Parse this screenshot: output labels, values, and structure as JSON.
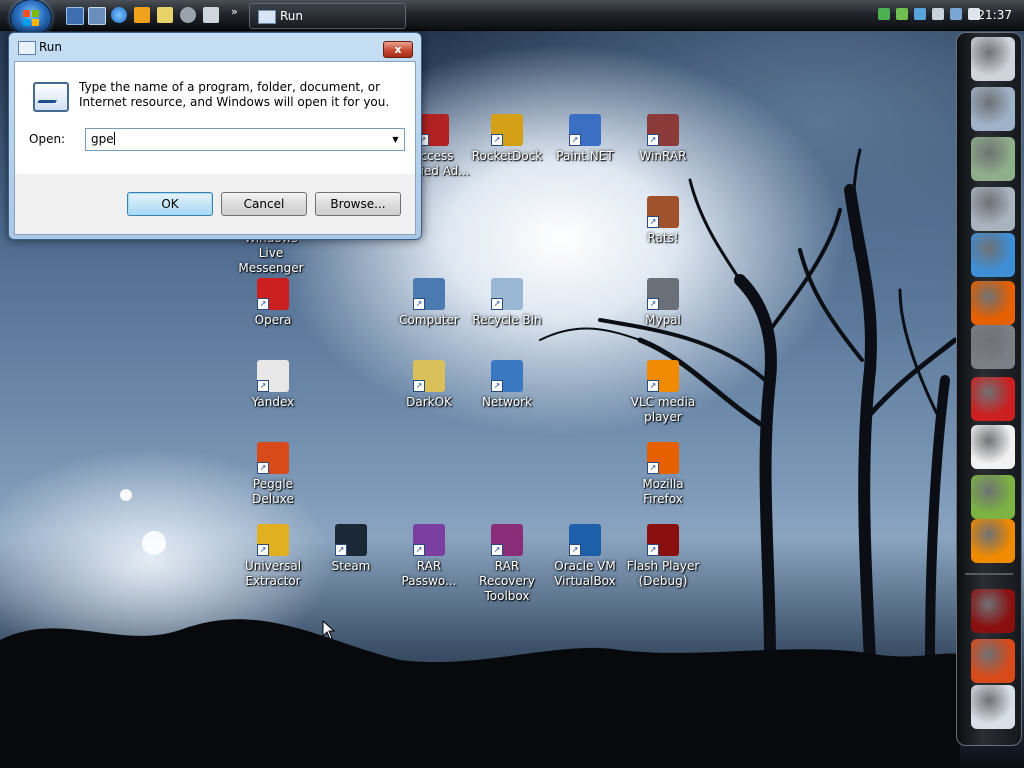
{
  "taskbar": {
    "start_button": "start-orb",
    "quick_launch": [
      "show-desktop-icon",
      "window-switch-icon",
      "internet-explorer-icon",
      "media-player-icon",
      "volume-icon",
      "eye-icon",
      "virtualbox-icon"
    ],
    "quick_launch_more": "»",
    "tasks": [
      {
        "label": "Run"
      }
    ],
    "clock": "21:37"
  },
  "run_dialog": {
    "title": "Run",
    "close_label": "x",
    "description": "Type the name of a program, folder, document, or Internet resource, and Windows will open it for you.",
    "open_label": "Open:",
    "open_value": "gpe",
    "buttons": {
      "ok": "OK",
      "cancel": "Cancel",
      "browse": "Browse..."
    }
  },
  "desktop_icons": [
    {
      "label": "Access Denied Ad...",
      "color": "#b22222"
    },
    {
      "label": "RocketDock",
      "color": "#d4a017"
    },
    {
      "label": "Paint.NET",
      "color": "#3a6fc4"
    },
    {
      "label": "WinRAR",
      "color": "#8b3a3a"
    },
    {
      "label": "Windows Live Messenger",
      "color": "#4aa3df"
    },
    {
      "label": "Rats!",
      "color": "#a0522d"
    },
    {
      "label": "Opera",
      "color": "#cc1f1f"
    },
    {
      "label": "Computer",
      "color": "#4a7ab0"
    },
    {
      "label": "Recycle Bin",
      "color": "#9ab7d3"
    },
    {
      "label": "Mypal",
      "color": "#6a6f78"
    },
    {
      "label": "Yandex",
      "color": "#e8e8e8"
    },
    {
      "label": "DarkOK",
      "color": "#d9c05a"
    },
    {
      "label": "Network",
      "color": "#3b78c2"
    },
    {
      "label": "VLC media player",
      "color": "#f08a00"
    },
    {
      "label": "Peggle Deluxe",
      "color": "#d94a1a"
    },
    {
      "label": "Mozilla Firefox",
      "color": "#e66000"
    },
    {
      "label": "Universal Extractor",
      "color": "#e0b020"
    },
    {
      "label": "Steam",
      "color": "#1b2838"
    },
    {
      "label": "RAR Passwo...",
      "color": "#7a3fa0"
    },
    {
      "label": "RAR Recovery Toolbox",
      "color": "#8a2e7a"
    },
    {
      "label": "Oracle VM VirtualBox",
      "color": "#1d5fa8"
    },
    {
      "label": "Flash Player (Debug)",
      "color": "#8a1010"
    }
  ],
  "dock_items": [
    {
      "name": "notepad-icon",
      "color": "#cfd4da"
    },
    {
      "name": "folder-icon",
      "color": "#9fb2c8"
    },
    {
      "name": "folder-green-icon",
      "color": "#8fae8a"
    },
    {
      "name": "folder-settings-icon",
      "color": "#a9b3bf"
    },
    {
      "name": "users-icon",
      "color": "#3f8fd6"
    },
    {
      "name": "firefox-icon",
      "color": "#e66000"
    },
    {
      "name": "raccoon-icon",
      "color": "#7b7f86"
    },
    {
      "name": "opera-icon",
      "color": "#cc1f1f"
    },
    {
      "name": "yandex-icon",
      "color": "#f2f2f2"
    },
    {
      "name": "notepadpp-icon",
      "color": "#7cb342"
    },
    {
      "name": "vlc-icon",
      "color": "#f08a00"
    },
    {
      "name": "flash-icon",
      "color": "#8a1010"
    },
    {
      "name": "peggle-icon",
      "color": "#d94a1a"
    },
    {
      "name": "recycle-bin-icon",
      "color": "#d9dfe6"
    }
  ]
}
